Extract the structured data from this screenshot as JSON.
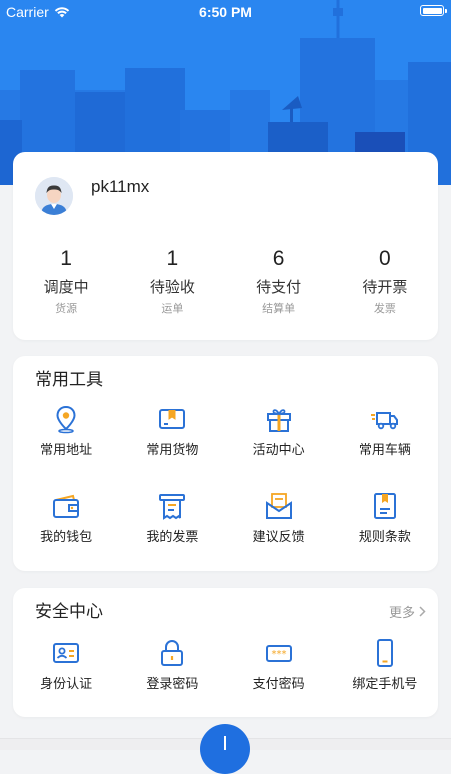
{
  "status_bar": {
    "carrier": "Carrier",
    "time": "6:50 PM"
  },
  "profile": {
    "username": "pk11mx"
  },
  "stats": [
    {
      "count": "1",
      "label": "调度中",
      "sub": "货源"
    },
    {
      "count": "1",
      "label": "待验收",
      "sub": "运单"
    },
    {
      "count": "6",
      "label": "待支付",
      "sub": "结算单"
    },
    {
      "count": "0",
      "label": "待开票",
      "sub": "发票"
    }
  ],
  "tools": {
    "title": "常用工具",
    "items": [
      {
        "label": "常用地址",
        "icon": "location-pin-icon"
      },
      {
        "label": "常用货物",
        "icon": "cargo-box-icon"
      },
      {
        "label": "活动中心",
        "icon": "gift-icon"
      },
      {
        "label": "常用车辆",
        "icon": "truck-icon"
      },
      {
        "label": "我的钱包",
        "icon": "wallet-icon"
      },
      {
        "label": "我的发票",
        "icon": "receipt-icon"
      },
      {
        "label": "建议反馈",
        "icon": "envelope-icon"
      },
      {
        "label": "规则条款",
        "icon": "rules-book-icon"
      }
    ]
  },
  "security": {
    "title": "安全中心",
    "more": "更多",
    "items": [
      {
        "label": "身份认证",
        "icon": "id-card-icon"
      },
      {
        "label": "登录密码",
        "icon": "lock-icon"
      },
      {
        "label": "支付密码",
        "icon": "password-dots-icon"
      },
      {
        "label": "绑定手机号",
        "icon": "phone-icon"
      }
    ]
  },
  "colors": {
    "primary": "#1e6fe0",
    "icon_blue": "#2b72d6",
    "icon_orange": "#f5a623",
    "hero_light": "#2f8ef5"
  }
}
